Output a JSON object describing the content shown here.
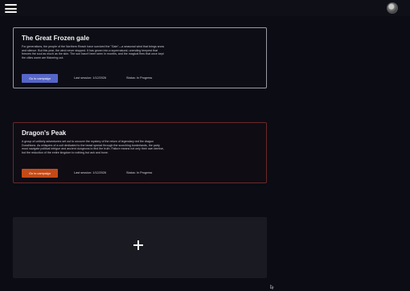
{
  "header": {
    "menu_icon": "hamburger-menu-icon",
    "avatar_icon": "user-avatar"
  },
  "campaigns": [
    {
      "title": "The Great Frozen gale",
      "description": "For generations, the people of the Northern Reach have survived the \"Gale\"—a seasonal wind that brings snow and silence. But this year, the wind never stopped. It has grown into a supernatural, unending tempest that freezes the soul as much as the skin. The sun hasn't been seen in months, and the magical fires that once kept the cities warm are flickering out.",
      "button_label": "Go to campaign",
      "last_session": "Last session: 1/12/2026",
      "status": "Status: In Progress",
      "accent": "#5666c8"
    },
    {
      "title": "Dragon's Peak",
      "description": "A group of unlikely adventurers set out to uncover the mystery of the return of legendary red fire dragon Duraihions. As whispers of a cult dedicated to the beast spread through the scorching borderlands, the party must navigate political intrigue and ancient dungeons to find the truth. Failure means not only their own demise, but the reduction of the entire kingdom to nothing but ash and bone.",
      "button_label": "Go to campaign",
      "last_session": "Last session: 1/12/2026",
      "status": "Status: In Progress",
      "accent": "#c44a17"
    }
  ],
  "add_card": {
    "icon": "plus-icon"
  }
}
